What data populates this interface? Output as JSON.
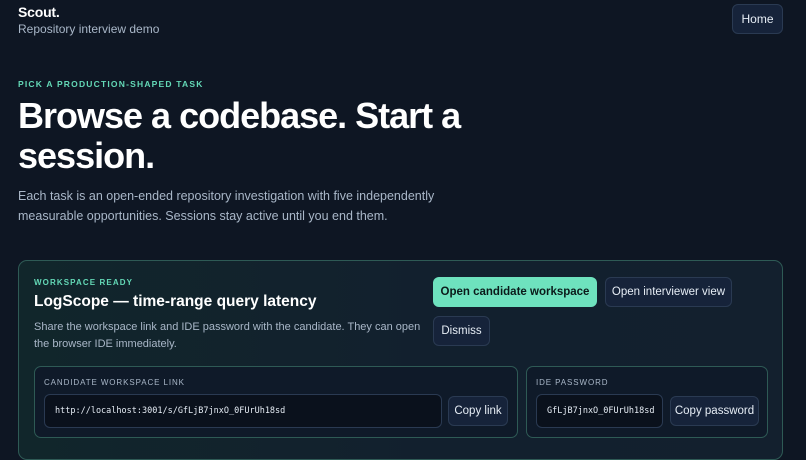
{
  "header": {
    "brand": "Scout.",
    "subtitle": "Repository interview demo",
    "home_label": "Home"
  },
  "hero": {
    "eyebrow": "PICK A PRODUCTION-SHAPED TASK",
    "headline": "Browse a codebase. Start a session.",
    "lead": "Each task is an open-ended repository investigation with five independently measurable opportunities. Sessions stay active until you end them."
  },
  "workspace": {
    "status": "WORKSPACE READY",
    "title": "LogScope — time-range query latency",
    "description": "Share the workspace link and IDE password with the candidate. They can open the browser IDE immediately.",
    "open_candidate_label": "Open candidate workspace",
    "open_interviewer_label": "Open interviewer view",
    "dismiss_label": "Dismiss",
    "link_panel": {
      "label": "CANDIDATE WORKSPACE LINK",
      "value": "http://localhost:3001/s/GfLjB7jnxO_0FUrUh18sd",
      "copy_label": "Copy link"
    },
    "password_panel": {
      "label": "IDE PASSWORD",
      "value": "GfLjB7jnxO_0FUrUh18sd",
      "copy_label": "Copy password"
    }
  },
  "colors": {
    "background": "#0e1623",
    "accent": "#6ee2be",
    "accent_text": "#63d8b6"
  }
}
